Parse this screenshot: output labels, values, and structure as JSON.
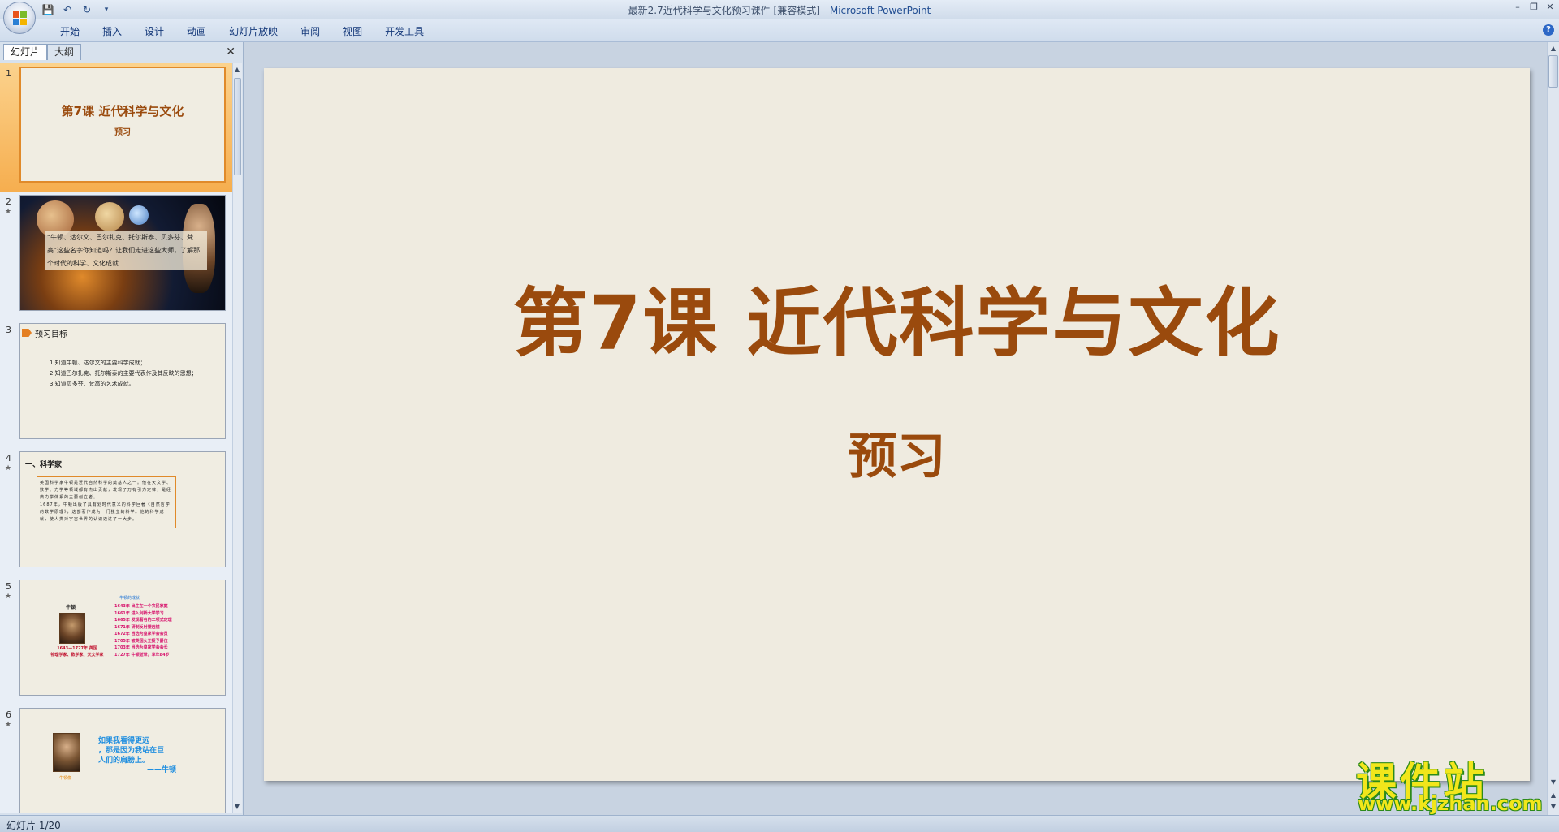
{
  "window": {
    "title": "最新2.7近代科学与文化预习课件 [兼容模式] - ",
    "app_name": "Microsoft PowerPoint"
  },
  "ribbon": {
    "tabs": [
      "开始",
      "插入",
      "设计",
      "动画",
      "幻灯片放映",
      "审阅",
      "视图",
      "开发工具"
    ]
  },
  "left_pane": {
    "tab_slides": "幻灯片",
    "tab_outline": "大纲"
  },
  "thumbnails": {
    "numbers": [
      "1",
      "2",
      "3",
      "4",
      "5",
      "6"
    ],
    "s1": {
      "title": "第7课 近代科学与文化",
      "subtitle": "预习"
    },
    "s2": {
      "text": "“牛顿、达尔文、巴尔扎克、托尔斯泰、贝多芬、梵高”这些名字你知道吗？让我们走进这些大师，了解那个时代的科学、文化成就"
    },
    "s3": {
      "heading": "预习目标",
      "lines": [
        "1.知道牛顿、达尔文的主要科学成就；",
        "2.知道巴尔扎克、托尔斯泰的主要代表作及其反映的思想；",
        "3.知道贝多芬、梵高的艺术成就。"
      ]
    },
    "s4": {
      "heading": "一、科学家",
      "para1": "英国科学家牛顿是近代自然科学的奠基人之一。他在天文学、数学、力学等领域都有杰出贡献，发现了万有引力定律，是经典力学体系的主要创立者。",
      "para2": "1687年，牛顿出版了具有划时代意义的科学巨著《自然哲学的数学原理》，这部著作成为一门独立的科学。他的科学成就，使人类对宇宙世界的认识迈进了一大步。"
    },
    "s5": {
      "name": "牛顿",
      "caption1": "1643—1727年 英国",
      "caption2": "物理学家、数学家、天文学家",
      "head": "牛顿的成就",
      "timeline": [
        "1643年  出生在一个农民家庭",
        "1661年  进入剑桥大学学习",
        "1665年  发现著名的二项式定理",
        "1671年  研制反射望远镜",
        "1672年  当选为皇家学会会员",
        "1705年  被英国女王授予爵位",
        "1703年  当选为皇家学会会长",
        "1727年  牛顿逝世，享年84岁"
      ]
    },
    "s6": {
      "quote_lines": [
        "如果我看得更远",
        "，那是因为我站在巨",
        "人们的肩膀上。",
        "——牛顿"
      ],
      "caption": "牛顿像"
    }
  },
  "slide": {
    "title": "第7课  近代科学与文化",
    "subtitle": "预习"
  },
  "watermark": {
    "main": "课件站",
    "url": "www.kjzhan.com"
  },
  "status": {
    "slide_indicator": "幻灯片 1/20"
  },
  "colors": {
    "title_brown": "#9a4a0d",
    "selection_orange": "#f6ae4f",
    "slide_bg": "#efebe0"
  }
}
